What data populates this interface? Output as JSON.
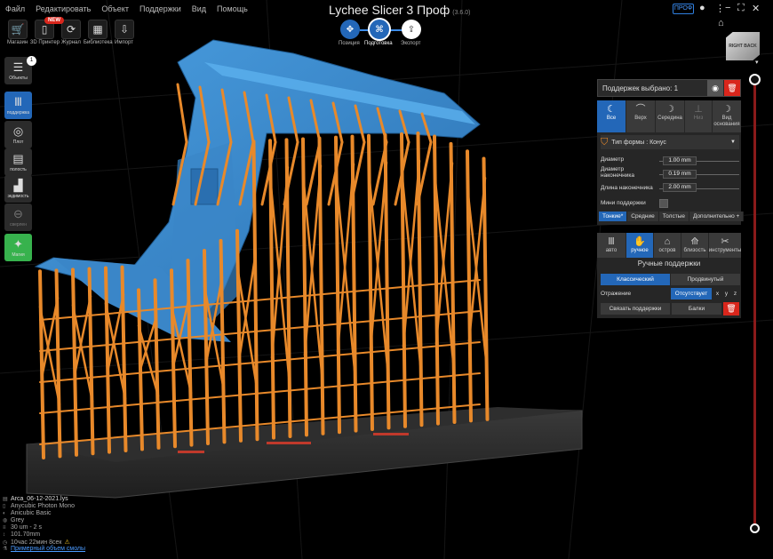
{
  "menu": [
    "Файл",
    "Редактировать",
    "Объект",
    "Поддержки",
    "Вид",
    "Помощь"
  ],
  "app": {
    "title": "Lychee Slicer 3 Проф",
    "version": "(3.6.0)",
    "badge": "ПРОФ"
  },
  "top_tools": [
    {
      "label": "Магазин",
      "icon": "cart-icon",
      "glyph": "🛒"
    },
    {
      "label": "3D Принтер",
      "icon": "printer-icon",
      "glyph": "▯",
      "badge": "NEW"
    },
    {
      "label": "Журнал",
      "icon": "journal-icon",
      "glyph": "⟳"
    },
    {
      "label": "Библиотека",
      "icon": "library-icon",
      "glyph": "▦"
    },
    {
      "label": "Импорт",
      "icon": "import-icon",
      "glyph": "⇩"
    }
  ],
  "modes": [
    {
      "label": "Позиция",
      "glyph": "✥",
      "active": false
    },
    {
      "label": "Подготовка",
      "glyph": "⌘",
      "active": true
    },
    {
      "label": "Экспорт",
      "glyph": "⇪",
      "active": false
    }
  ],
  "left_tools": [
    {
      "label": "Объекты",
      "glyph": "☰",
      "badge": "1",
      "style": "dark"
    },
    {
      "label": "поддержка",
      "glyph": "Ⅲ",
      "style": "blue"
    },
    {
      "label": "Плот",
      "glyph": "◎",
      "style": "dark"
    },
    {
      "label": "полость",
      "glyph": "▤",
      "style": "dark"
    },
    {
      "label": "экдимость",
      "glyph": "▟",
      "style": "dark"
    },
    {
      "label": "сверлен",
      "glyph": "⊖",
      "style": "dark"
    },
    {
      "label": "Магия",
      "glyph": "✦",
      "style": "green"
    }
  ],
  "supports_panel": {
    "selected": "Поддержек выбрано: 1",
    "tabs": [
      {
        "label": "Все",
        "state": "active"
      },
      {
        "label": "Верх",
        "state": "inactive"
      },
      {
        "label": "Середина",
        "state": "inactive"
      },
      {
        "label": "Низ",
        "state": "disabled"
      },
      {
        "label": "Вид основания",
        "state": "inactive"
      }
    ],
    "shape": "Тип формы : Конус",
    "params": [
      {
        "label": "Диаметр",
        "value": "1.00 mm"
      },
      {
        "label": "Диаметр наконечника",
        "value": "0.19 mm"
      },
      {
        "label": "Длина наконечника",
        "value": "2.00 mm"
      }
    ],
    "mini_label": "Мини поддержки",
    "presets": [
      "Тонкие*",
      "Средние",
      "Толстые",
      "Дополнительно +"
    ]
  },
  "manual_panel": {
    "tabs": [
      {
        "label": "авто",
        "glyph": "Ⅲ",
        "state": "inactive"
      },
      {
        "label": "ручное",
        "glyph": "✋",
        "state": "active"
      },
      {
        "label": "остров",
        "glyph": "⌂",
        "state": "inactive"
      },
      {
        "label": "близость",
        "glyph": "⟰",
        "state": "inactive"
      },
      {
        "label": "инструменты",
        "glyph": "✂",
        "state": "inactive"
      }
    ],
    "title": "Ручные поддержки",
    "mode_classic": "Классический",
    "mode_advanced": "Продвинутый",
    "mirror_label": "Отражение",
    "mirror_value": "Отсутствует",
    "axes": [
      "x",
      "y",
      "z"
    ],
    "link_button": "Связать поддержки",
    "beams_button": "Балки"
  },
  "file_info": [
    {
      "icon": "file-icon",
      "text": "Arca_06-12-2021.lys"
    },
    {
      "icon": "printer-icon",
      "text": "Anycubic Photon Mono"
    },
    {
      "icon": "resin-icon",
      "text": "Anicubic Basic"
    },
    {
      "icon": "color-icon",
      "text": "Grey"
    },
    {
      "icon": "layer-icon",
      "text": "30 um - 2 s"
    },
    {
      "icon": "height-icon",
      "text": "101.70mm"
    },
    {
      "icon": "time-icon",
      "text": "10час 22мин 8сек"
    },
    {
      "icon": "volume-icon",
      "text": "Примерный объем смолы"
    }
  ],
  "viewcube": {
    "left": "RIGHT",
    "right": "BACK"
  }
}
